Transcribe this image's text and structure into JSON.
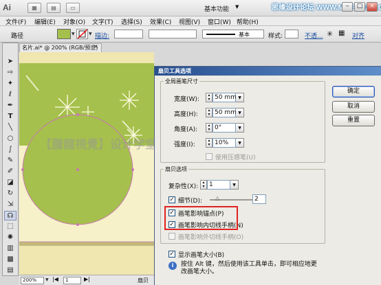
{
  "app": {
    "logo": "Ai",
    "workspace": "基本功能",
    "top_watermark": "思缘设计论坛 WWW.MISSYUAN.COM"
  },
  "menu": [
    "文件(F)",
    "编辑(E)",
    "对象(O)",
    "文字(T)",
    "选择(S)",
    "效果(C)",
    "视图(V)",
    "窗口(W)",
    "帮助(H)"
  ],
  "control": {
    "object_type": "路径",
    "stroke_label": "描边:",
    "stroke_style": "基本",
    "style_label": "样式:",
    "opacity_label": "不透...",
    "align_label": "对齐"
  },
  "document": {
    "tab": "名片.ai* @ 200% (RGB/预览)",
    "watermark": "【騰龍視覺】设计学堂 YY 频道 ID：80101",
    "zoom": "200%",
    "page": "1",
    "status": "扇贝"
  },
  "dialog": {
    "title": "扇贝工具选项",
    "brush_section": "全局画笔尺寸",
    "width_label": "宽度(W):",
    "width_value": "50 mm",
    "height_label": "高度(H):",
    "height_value": "50 mm",
    "angle_label": "角度(A):",
    "angle_value": "0°",
    "intensity_label": "强度(I):",
    "intensity_value": "10%",
    "pressure_label": "使用压感笔(U)",
    "scallop_section": "扇贝选项",
    "complexity_label": "复杂性(X):",
    "complexity_value": "1",
    "detail_label": "细节(D):",
    "detail_value": "2",
    "anchor_label": "画笔影响锚点(P)",
    "in_tangent_label": "画笔影响内切线手柄(N)",
    "out_tangent_label": "画笔影响外切线手柄(O)",
    "show_size_label": "显示画笔大小(B)",
    "hint": "按住 Alt 键，然后使用该工具单击，即可相应地更改画笔大小。",
    "ok": "确定",
    "cancel": "取消",
    "reset": "重置"
  },
  "colors": {
    "accent": "#2c55b0",
    "artwork_green": "#a5c04c",
    "highlight": "#e02222",
    "canvas_bg": "#f6f1c8"
  }
}
